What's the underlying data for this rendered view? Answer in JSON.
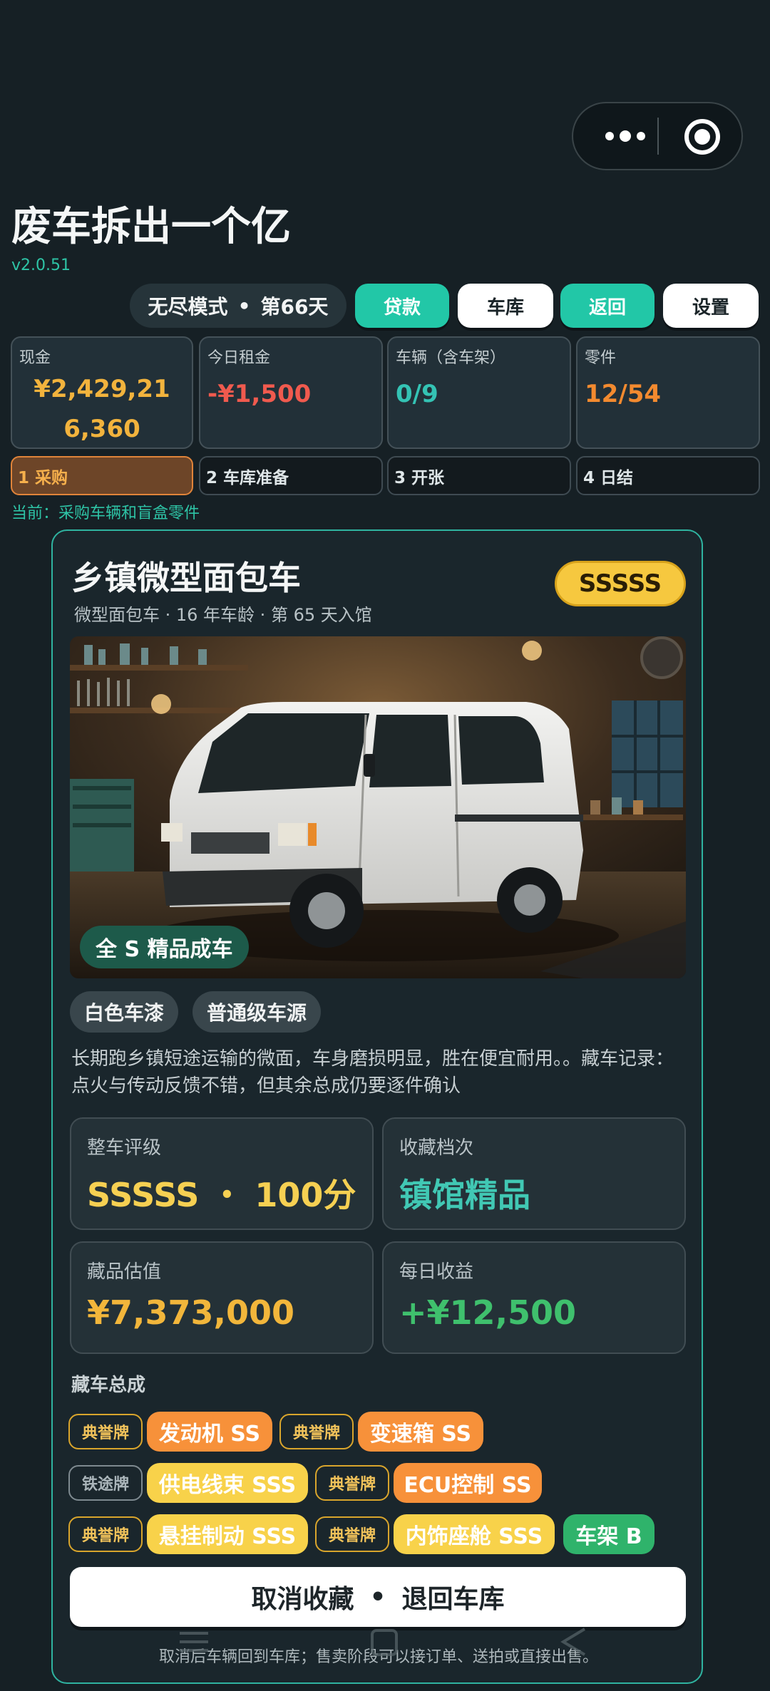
{
  "capsule": {
    "more_icon": "more-dots-icon",
    "close_icon": "target-circle-icon"
  },
  "header": {
    "title": "废车拆出一个亿",
    "version": "v2.0.51"
  },
  "mode": {
    "name": "无尽模式",
    "sep": "•",
    "day": "第66天"
  },
  "actions": {
    "loan": "贷款",
    "garage": "车库",
    "back": "返回",
    "settings": "设置"
  },
  "stats": {
    "cash_label": "现金",
    "cash_line1": "¥2,429,21",
    "cash_line2": "6,360",
    "rent_label": "今日租金",
    "rent_value": "-¥1,500",
    "vehicles_label": "车辆（含车架）",
    "vehicles_value": "0/9",
    "parts_label": "零件",
    "parts_value": "12/54"
  },
  "steps": [
    "1 采购",
    "2 车库准备",
    "3 开张",
    "4 日结"
  ],
  "current_step": "当前：采购车辆和盲盒零件",
  "car": {
    "name": "乡镇微型面包车",
    "meta": "微型面包车 · 16 年车龄 · 第 65 天入馆",
    "grade_badge": "SSSSS",
    "photo_tag": "全 S 精品成车",
    "tags": [
      "白色车漆",
      "普通级车源"
    ],
    "description": "长期跑乡镇短途运输的微面，车身磨损明显，胜在便宜耐用。。藏车记录：点火与传动反馈不错，但其余总成仍要逐件确认",
    "rating_label": "整车评级",
    "rating_value": "SSSSS ・ 100分",
    "tier_label": "收藏档次",
    "tier_value": "镇馆精品",
    "valuation_label": "藏品估值",
    "valuation_value": "¥7,373,000",
    "daily_label": "每日收益",
    "daily_value": "+¥12,500",
    "assemblies_label": "藏车总成",
    "assemblies": {
      "b1": "典誉牌",
      "p1": "发动机 SS",
      "b2": "典誉牌",
      "p2": "变速箱 SS",
      "b3": "铁途牌",
      "p3": "供电线束 SSS",
      "b4": "典誉牌",
      "p4": "ECU控制 SS",
      "b5": "典誉牌",
      "p5": "悬挂制动 SSS",
      "b6": "典誉牌",
      "p6": "内饰座舱 SSS",
      "frame": "车架 B"
    },
    "cancel_button": {
      "left": "取消收藏",
      "sep": "•",
      "right": "退回车库"
    },
    "footnote": "取消后车辆回到车库；售卖阶段可以接订单、送拍或直接出售。"
  },
  "colors": {
    "accent": "#22c7a7",
    "cash": "#f2b33d",
    "rent": "#f05a4e",
    "parts": "#f38a2f",
    "badge": "#f6c83f"
  }
}
